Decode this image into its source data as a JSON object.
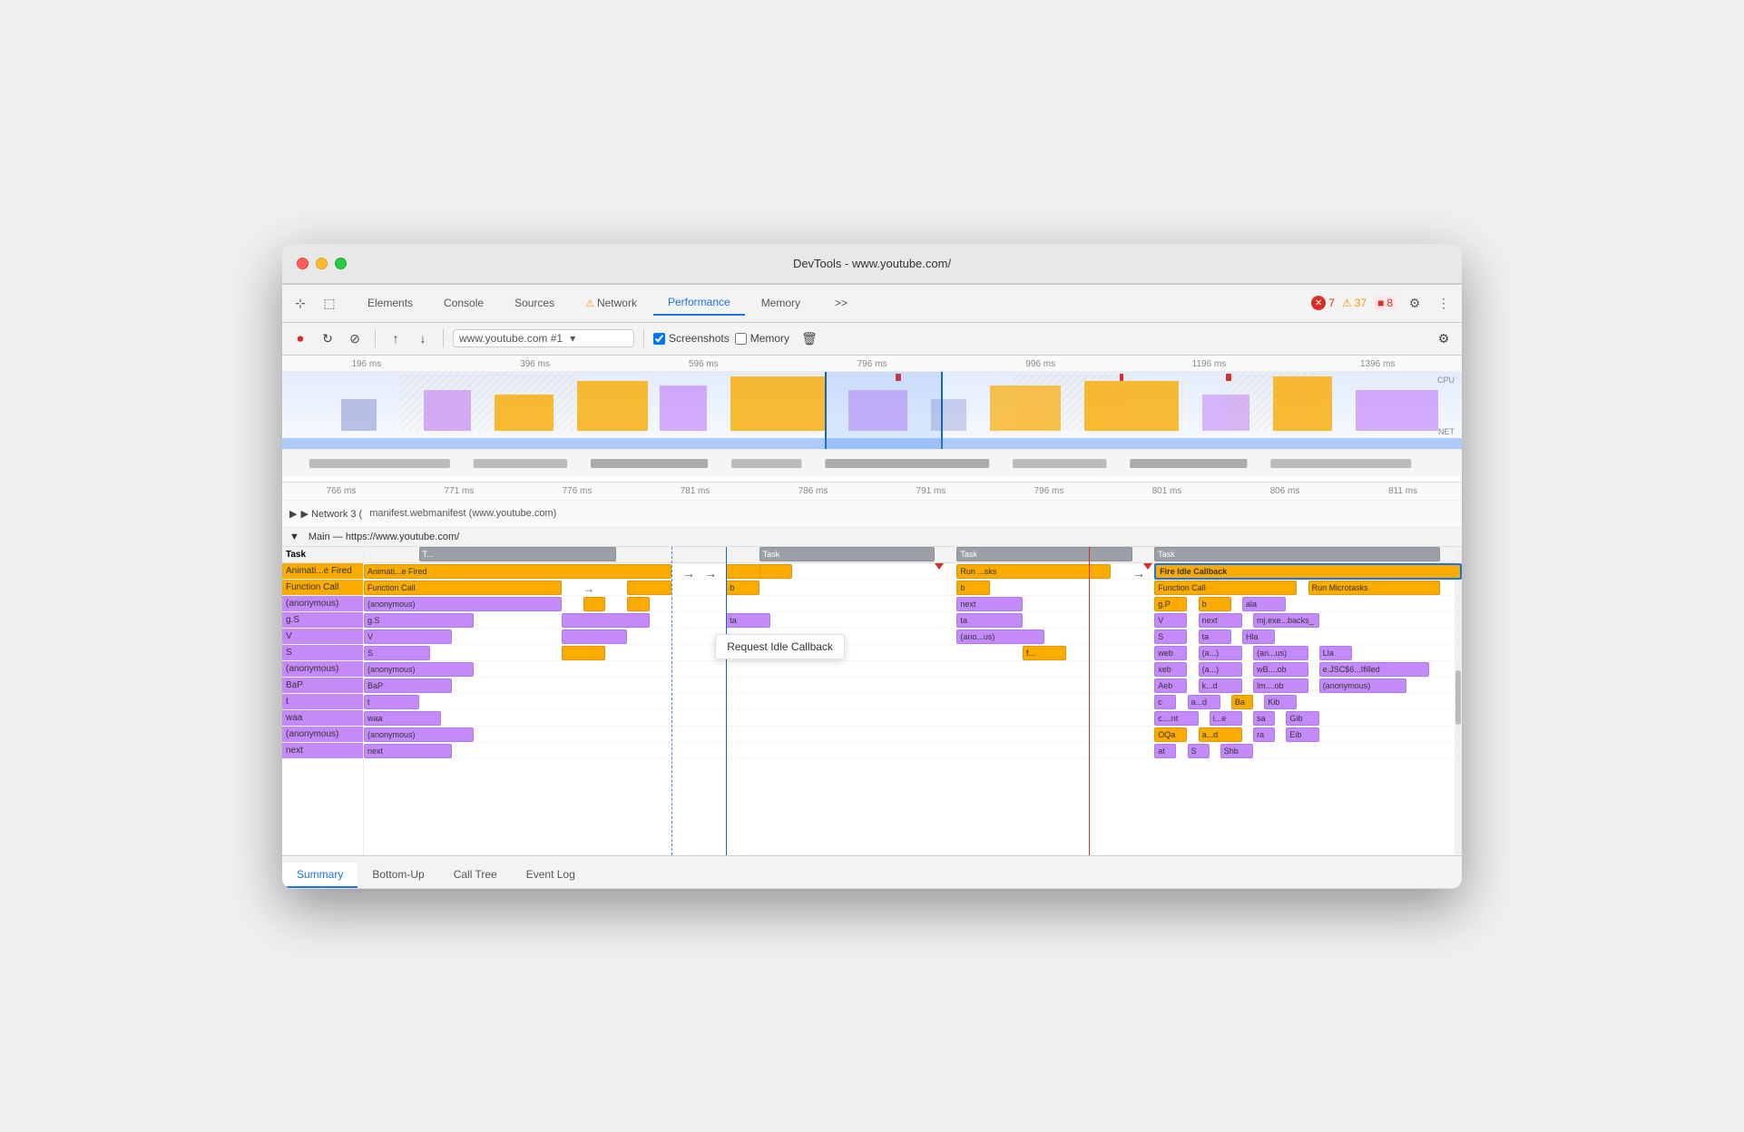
{
  "window": {
    "title": "DevTools - www.youtube.com/"
  },
  "tabs": {
    "items": [
      {
        "label": "Elements",
        "active": false,
        "warning": false
      },
      {
        "label": "Console",
        "active": false,
        "warning": false
      },
      {
        "label": "Sources",
        "active": false,
        "warning": false
      },
      {
        "label": "Network",
        "active": false,
        "warning": true
      },
      {
        "label": "Performance",
        "active": true,
        "warning": false
      },
      {
        "label": "Memory",
        "active": false,
        "warning": false
      }
    ],
    "more_label": ">>",
    "badges": {
      "errors": "7",
      "warnings": "37",
      "info": "8"
    }
  },
  "toolbar": {
    "url": "www.youtube.com #1",
    "screenshots_label": "Screenshots",
    "memory_label": "Memory",
    "screenshots_checked": true,
    "memory_checked": false
  },
  "timeline": {
    "timestamps_top": [
      "196 ms",
      "396 ms",
      "596 ms",
      "796 ms",
      "996 ms",
      "1196 ms",
      "1396 ms"
    ],
    "timestamps_zoom": [
      "766 ms",
      "771 ms",
      "776 ms",
      "781 ms",
      "786 ms",
      "791 ms",
      "796 ms",
      "801 ms",
      "806 ms",
      "811 ms"
    ],
    "cpu_label": "CPU",
    "net_label": "NET"
  },
  "network_row": {
    "label": "▶ Network 3 (",
    "manifest_label": "manifest.webmanifest (www.youtube.com)"
  },
  "main_section": {
    "header": "▼ Main — https://www.youtube.com/"
  },
  "flame_rows": {
    "left_labels": [
      "Task",
      "Animati...e Fired",
      "Function Call",
      "(anonymous)",
      "g.S",
      "V",
      "S",
      "(anonymous)",
      "BaP",
      "t",
      "waa",
      "(anonymous)",
      "next"
    ],
    "header_tasks": [
      "T...",
      "Task",
      "Task",
      "Task"
    ],
    "mid_blocks": [
      {
        "label": "b",
        "col": "yellow"
      },
      {
        "label": "b",
        "col": "yellow"
      },
      {
        "label": "next",
        "col": "purple"
      },
      {
        "label": "ta",
        "col": "purple"
      },
      {
        "label": "(ano...us)",
        "col": "purple"
      },
      {
        "label": "f...",
        "col": "yellow"
      }
    ],
    "right_blocks": [
      {
        "label": "Run ...sks",
        "col": "yellow"
      },
      {
        "label": "b",
        "col": "yellow"
      },
      {
        "label": "next",
        "col": "purple"
      },
      {
        "label": "ta",
        "col": "purple"
      }
    ],
    "fire_idle": {
      "label": "Fire Idle Callback",
      "sub": [
        {
          "col1": "Function Call",
          "col2": "Run Microtasks"
        },
        {
          "col1": "g.P",
          "col2": "b",
          "col3": "ala"
        },
        {
          "col1": "V",
          "col2": "next",
          "col3": "mj.exe...backs_"
        },
        {
          "col1": "S",
          "col2": "ta",
          "col3": "Hla"
        },
        {
          "col1": "web",
          "col2": "(a...)",
          "col3": "(an...us)",
          "col4": "Lla"
        },
        {
          "col1": "xeb",
          "col2": "(a...)",
          "col3": "wB....ob",
          "col4": "e.JSC$6...Ifilled"
        },
        {
          "col1": "Aeb",
          "col2": "k...d",
          "col3": "lm....ob",
          "col4": "(anonymous)"
        },
        {
          "col1": "c",
          "col2": "a...d",
          "col3": "Ba",
          "col4": "Kib"
        },
        {
          "col1": "c....nt",
          "col2": "i...e",
          "col3": "sa",
          "col4": "Gib"
        },
        {
          "col1": "OQa",
          "col2": "a...d",
          "col3": "ra",
          "col4": "Eib"
        },
        {
          "col1": "at",
          "col2": "S",
          "col3": "Shb"
        }
      ]
    },
    "tooltip": "Request Idle Callback"
  },
  "bottom_tabs": [
    {
      "label": "Summary",
      "active": true
    },
    {
      "label": "Bottom-Up",
      "active": false
    },
    {
      "label": "Call Tree",
      "active": false
    },
    {
      "label": "Event Log",
      "active": false
    }
  ]
}
